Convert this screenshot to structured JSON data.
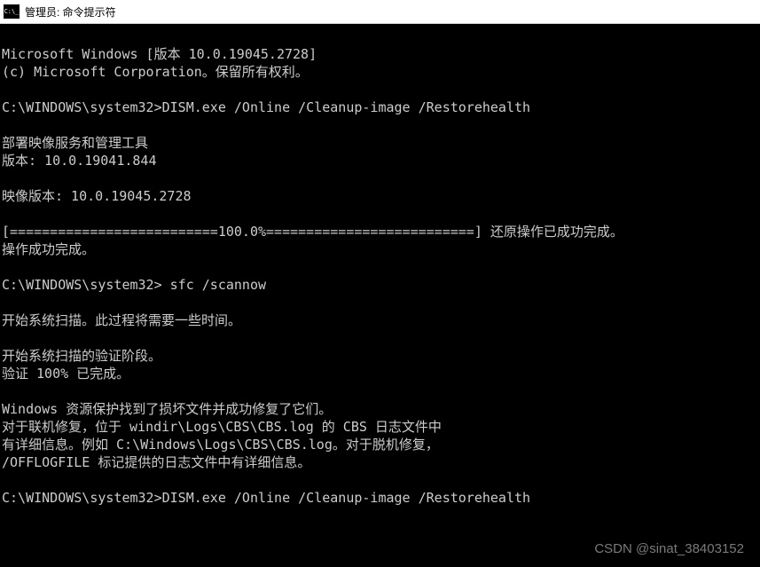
{
  "window": {
    "title": "管理员: 命令提示符"
  },
  "terminal": {
    "line1": "Microsoft Windows [版本 10.0.19045.2728]",
    "line2": "(c) Microsoft Corporation。保留所有权利。",
    "line3": "",
    "line4": "C:\\WINDOWS\\system32>DISM.exe /Online /Cleanup-image /Restorehealth",
    "line5": "",
    "line6": "部署映像服务和管理工具",
    "line7": "版本: 10.0.19041.844",
    "line8": "",
    "line9": "映像版本: 10.0.19045.2728",
    "line10": "",
    "line11": "[==========================100.0%==========================] 还原操作已成功完成。",
    "line12": "操作成功完成。",
    "line13": "",
    "line14": "C:\\WINDOWS\\system32> sfc /scannow",
    "line15": "",
    "line16": "开始系统扫描。此过程将需要一些时间。",
    "line17": "",
    "line18": "开始系统扫描的验证阶段。",
    "line19": "验证 100% 已完成。",
    "line20": "",
    "line21": "Windows 资源保护找到了损坏文件并成功修复了它们。",
    "line22": "对于联机修复，位于 windir\\Logs\\CBS\\CBS.log 的 CBS 日志文件中",
    "line23": "有详细信息。例如 C:\\Windows\\Logs\\CBS\\CBS.log。对于脱机修复，",
    "line24": "/OFFLOGFILE 标记提供的日志文件中有详细信息。",
    "line25": "",
    "line26": "C:\\WINDOWS\\system32>DISM.exe /Online /Cleanup-image /Restorehealth"
  },
  "watermark": "CSDN @sinat_38403152"
}
